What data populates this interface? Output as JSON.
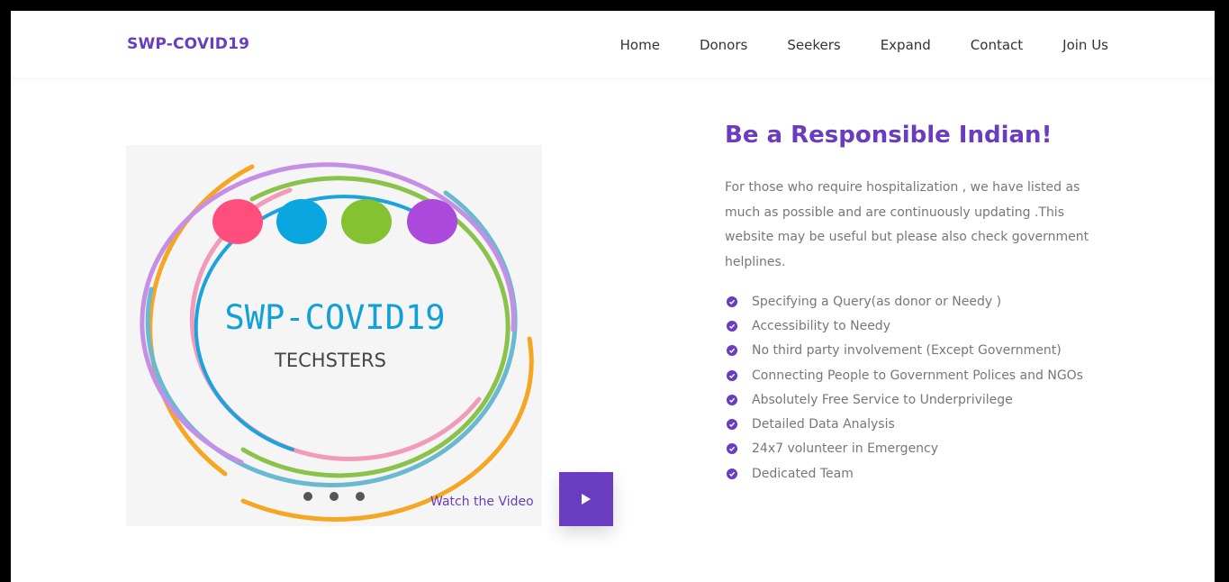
{
  "nav": {
    "brand": "SWP-COVID19",
    "links": [
      "Home",
      "Donors",
      "Seekers",
      "Expand",
      "Contact",
      "Join Us"
    ]
  },
  "media": {
    "logo_title": "SWP-COVID19",
    "logo_subtitle": "TECHSTERS",
    "watch_label": "Watch the Video"
  },
  "content": {
    "headline": "Be a Responsible Indian!",
    "description": "For those who require hospitalization , we have listed as much as possible and are continuously updating .This website may be useful but please also check government helplines.",
    "features": [
      "Specifying a Query(as donor or Needy )",
      "Accessibility to Needy",
      "No third party involvement (Except Government)",
      "Connecting People to Government Polices and NGOs",
      "Absolutely Free Service to Underprivilege",
      "Detailed Data Analysis",
      "24x7 volunteer in Emergency",
      "Dedicated Team"
    ]
  },
  "colors": {
    "accent": "#6a3cbf",
    "logo_dots": [
      "#ff4d7d",
      "#0aa6e0",
      "#84c232",
      "#aa49db"
    ],
    "logo_rings": [
      "#f5a623",
      "#6bb8d1",
      "#c58fe6",
      "#8bc34a",
      "#f19aba",
      "#1aa3dd"
    ]
  },
  "icons": {
    "play": "play-icon",
    "check": "check-circle-icon"
  }
}
